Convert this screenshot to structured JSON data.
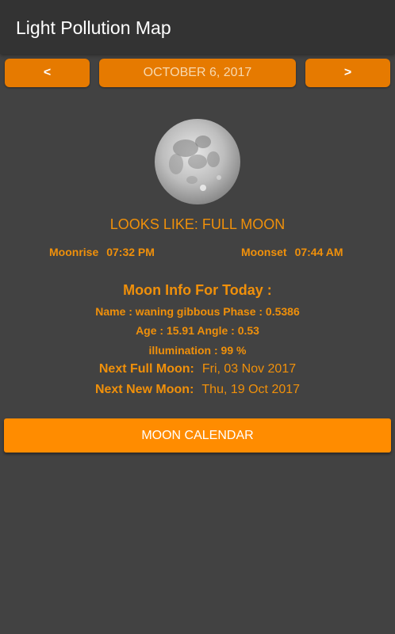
{
  "app": {
    "title": "Light Pollution Map"
  },
  "nav": {
    "prev_label": "<",
    "date": "OCTOBER 6, 2017",
    "next_label": ">"
  },
  "moon": {
    "looks_like": "LOOKS LIKE:  FULL MOON",
    "moonrise_label": "Moonrise",
    "moonrise": "07:32 PM",
    "moonset_label": "Moonset",
    "moonset": "07:44 AM"
  },
  "info": {
    "heading": "Moon Info For Today :",
    "line1": "Name : waning gibbous   Phase : 0.5386",
    "line2": "Age : 15.91   Angle : 0.53",
    "line3": "illumination : 99 %",
    "next_full_label": "Next Full Moon:",
    "next_full": "Fri, 03 Nov 2017",
    "next_new_label": "Next New Moon:",
    "next_new": "Thu, 19 Oct 2017"
  },
  "calendar_button": "MOON CALENDAR",
  "colors": {
    "accent": "#ff8c00",
    "text_orange": "#f0900a",
    "background": "#424242"
  }
}
